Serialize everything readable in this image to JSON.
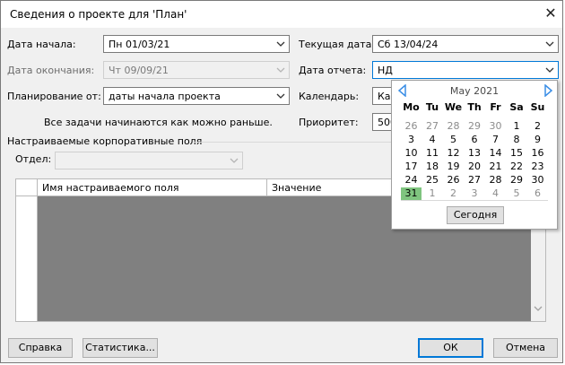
{
  "window": {
    "title": "Сведения о проекте для 'План'",
    "close_glyph": "✕"
  },
  "fields": {
    "start_date": {
      "label": "Дата начала:",
      "value": "Пн 01/03/21"
    },
    "finish_date": {
      "label": "Дата окончания:",
      "value": "Чт 09/09/21"
    },
    "schedule_from": {
      "label": "Планирование от:",
      "value": "даты начала проекта"
    },
    "schedule_note": "Все задачи начинаются как можно раньше.",
    "current_date": {
      "label": "Текущая дата:",
      "value": "Сб 13/04/24"
    },
    "status_date": {
      "label": "Дата отчета:",
      "value": "НД"
    },
    "calendar": {
      "label": "Календарь:",
      "value": "Ка"
    },
    "priority": {
      "label": "Приоритет:",
      "value": "500"
    }
  },
  "custom_fields": {
    "group_label": "Настраиваемые корпоративные поля",
    "department_label": "Отдел:",
    "department_value": "",
    "columns": [
      "Имя настраиваемого поля",
      "Значение"
    ]
  },
  "calendar_popup": {
    "month_label": "May 2021",
    "weekdays": [
      "Mo",
      "Tu",
      "We",
      "Th",
      "Fr",
      "Sa",
      "Su"
    ],
    "weeks": [
      [
        {
          "d": "26",
          "o": true
        },
        {
          "d": "27",
          "o": true
        },
        {
          "d": "28",
          "o": true
        },
        {
          "d": "29",
          "o": true
        },
        {
          "d": "30",
          "o": true
        },
        {
          "d": "1"
        },
        {
          "d": "2"
        }
      ],
      [
        {
          "d": "3"
        },
        {
          "d": "4"
        },
        {
          "d": "5"
        },
        {
          "d": "6"
        },
        {
          "d": "7"
        },
        {
          "d": "8"
        },
        {
          "d": "9"
        }
      ],
      [
        {
          "d": "10"
        },
        {
          "d": "11"
        },
        {
          "d": "12"
        },
        {
          "d": "13"
        },
        {
          "d": "14"
        },
        {
          "d": "15"
        },
        {
          "d": "16"
        }
      ],
      [
        {
          "d": "17"
        },
        {
          "d": "18"
        },
        {
          "d": "19"
        },
        {
          "d": "20"
        },
        {
          "d": "21"
        },
        {
          "d": "22"
        },
        {
          "d": "23"
        }
      ],
      [
        {
          "d": "24"
        },
        {
          "d": "25"
        },
        {
          "d": "26"
        },
        {
          "d": "27"
        },
        {
          "d": "28"
        },
        {
          "d": "29"
        },
        {
          "d": "30"
        }
      ],
      [
        {
          "d": "31",
          "s": true
        },
        {
          "d": "1",
          "o": true
        },
        {
          "d": "2",
          "o": true
        },
        {
          "d": "3",
          "o": true
        },
        {
          "d": "4",
          "o": true
        },
        {
          "d": "5",
          "o": true
        },
        {
          "d": "6",
          "o": true
        }
      ]
    ],
    "today_button": "Сегодня"
  },
  "buttons": {
    "help": "Справка",
    "stats": "Статистика...",
    "ok": "ОК",
    "cancel": "Отмена"
  },
  "colors": {
    "accent": "#0078d7",
    "selected_day": "#7fc47f",
    "nav_arrow": "#3a8ee6",
    "grid_body": "#808080"
  }
}
